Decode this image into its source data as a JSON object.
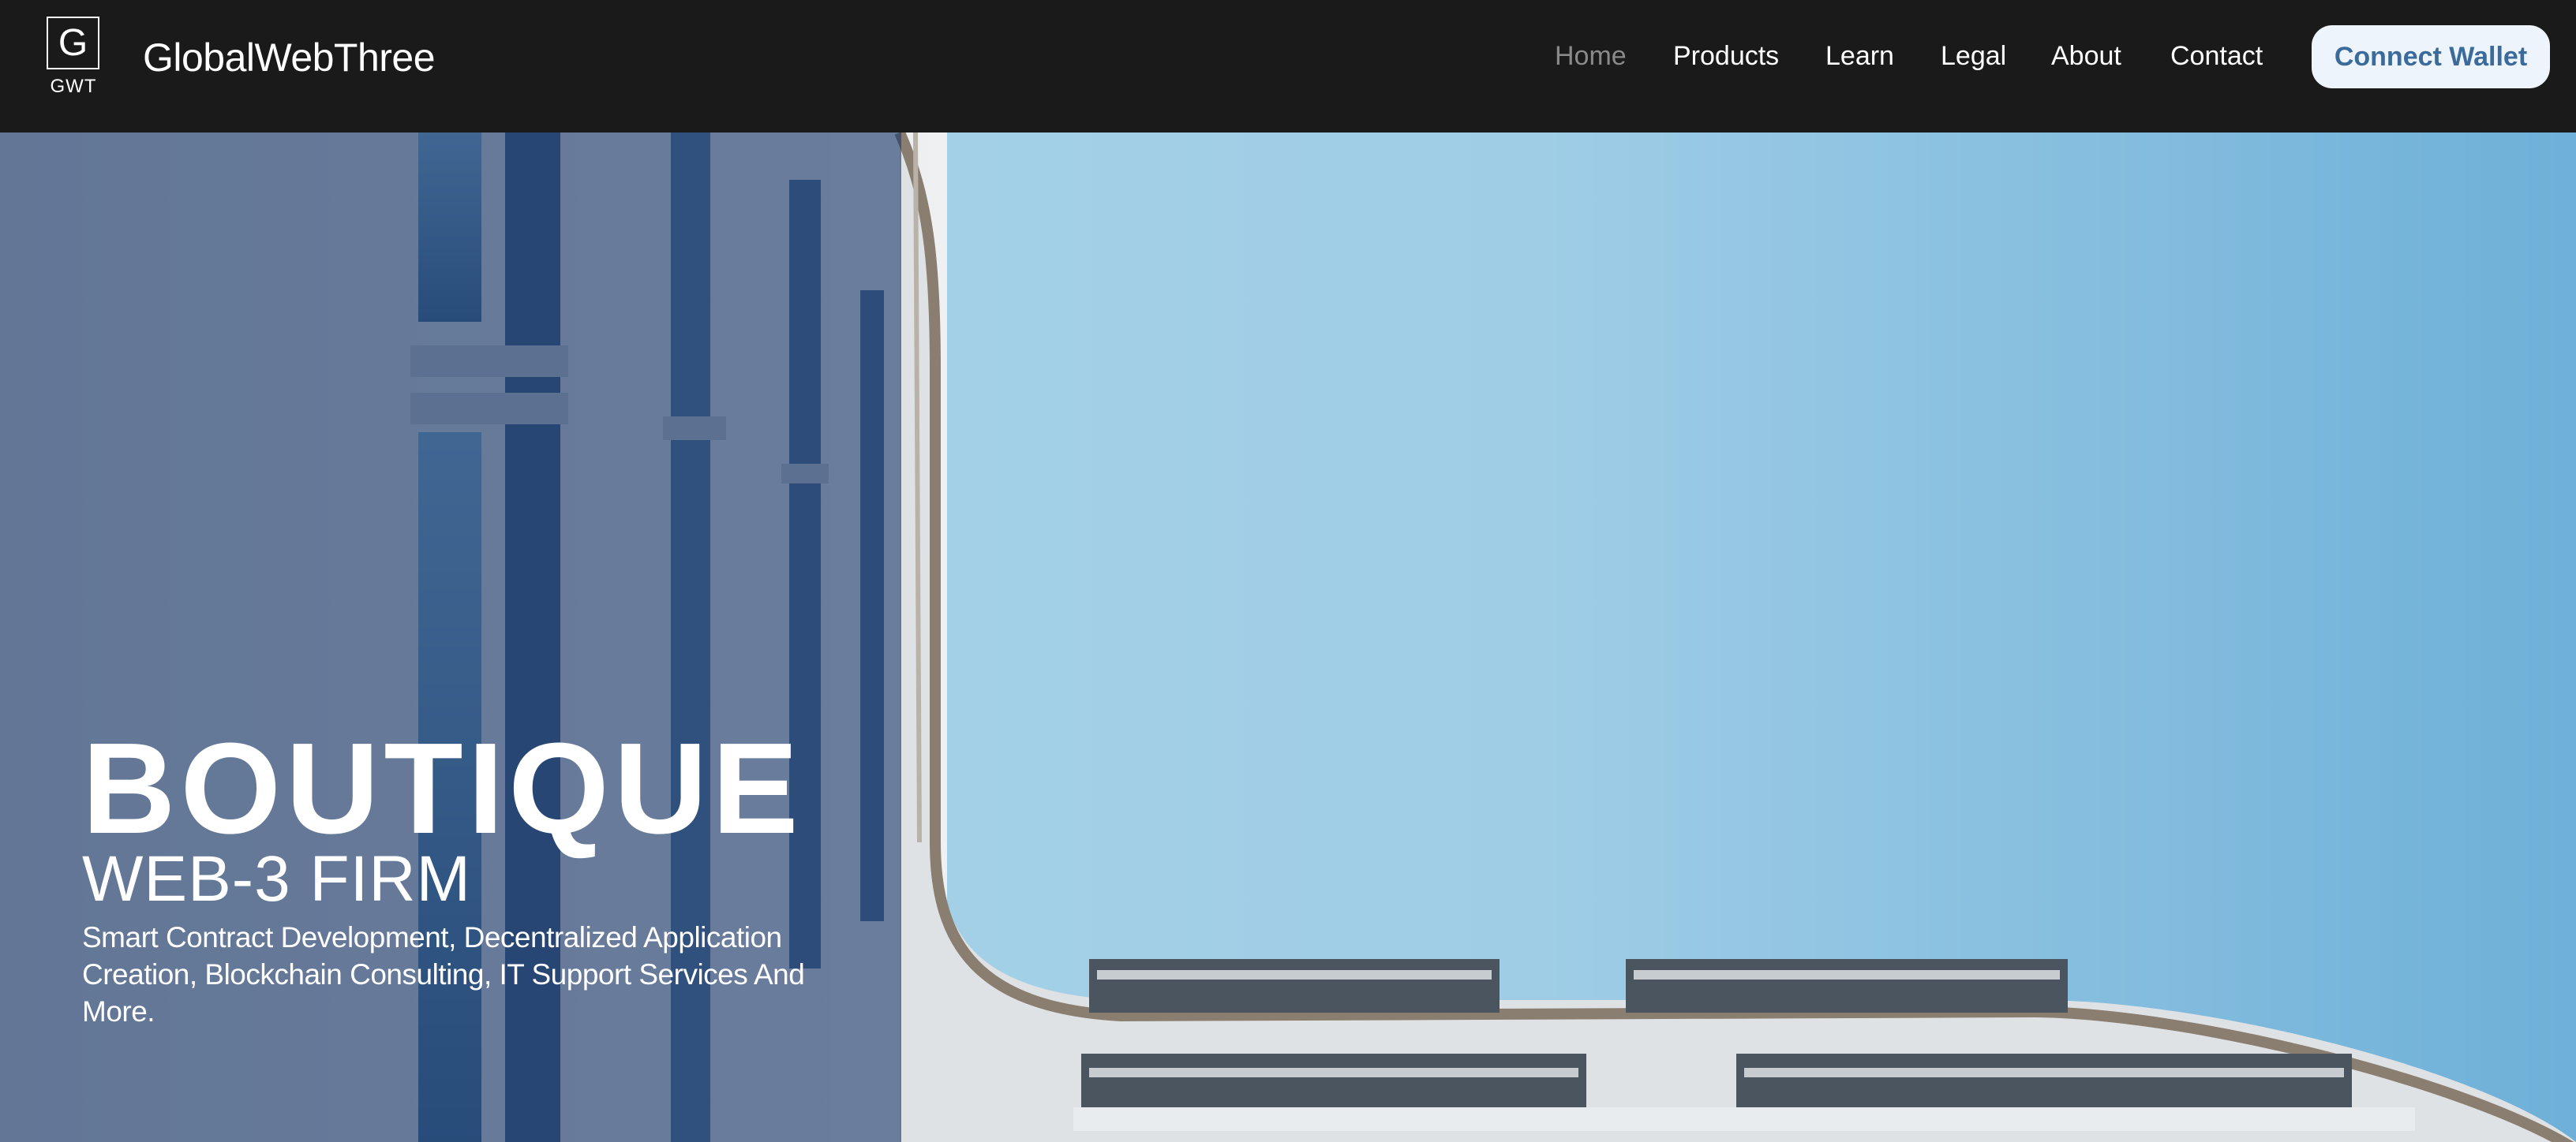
{
  "header": {
    "logo_letter": "G",
    "logo_sub": "GWT",
    "brand": "GlobalWebThree",
    "nav": [
      "Home",
      "Products",
      "Learn",
      "Legal",
      "About",
      "Contact"
    ],
    "active_nav": "Home",
    "connect_label": "Connect Wallet"
  },
  "hero": {
    "title": "BOUTIQUE",
    "subtitle": "WEB-3 FIRM",
    "description": "Smart Contract Development, Decentralized Application Creation, Blockchain Consulting, IT Support Services And More."
  },
  "colors": {
    "header_bg": "#1a1a1a",
    "accent_button_text": "#3a6b9b",
    "button_bg": "#eef4fb",
    "overlay": "#1a3769",
    "sky": "#8ec6e0"
  }
}
